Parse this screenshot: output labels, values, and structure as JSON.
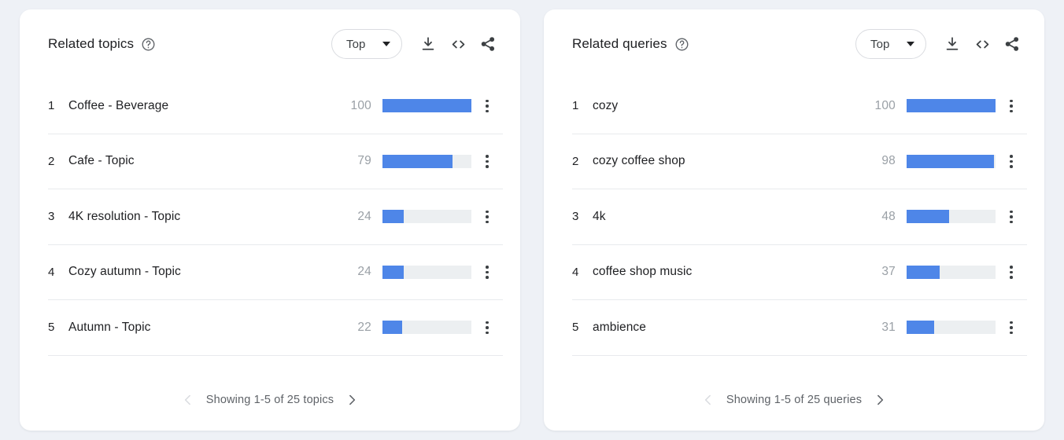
{
  "theme": {
    "page_background": "#eef1f6",
    "card_background": "#ffffff",
    "bar_fill_color": "#4e86e8",
    "bar_track_color": "#eceff1",
    "primary_text_color": "#202124",
    "muted_text_color": "#9aa0a6"
  },
  "panels": [
    {
      "title": "Related topics",
      "help_icon": "help-circle-icon",
      "sort_select": {
        "value": "Top",
        "caret_icon": "chevron-down-icon"
      },
      "actions": [
        {
          "name": "download-button",
          "icon": "download-icon"
        },
        {
          "name": "embed-button",
          "icon": "code-embed-icon"
        },
        {
          "name": "share-button",
          "icon": "share-icon"
        }
      ],
      "rows": [
        {
          "rank": "1",
          "label": "Coffee - Beverage",
          "value": "100",
          "percent": 100
        },
        {
          "rank": "2",
          "label": "Cafe - Topic",
          "value": "79",
          "percent": 79
        },
        {
          "rank": "3",
          "label": "4K resolution - Topic",
          "value": "24",
          "percent": 24
        },
        {
          "rank": "4",
          "label": "Cozy autumn - Topic",
          "value": "24",
          "percent": 24
        },
        {
          "rank": "5",
          "label": "Autumn - Topic",
          "value": "22",
          "percent": 22
        }
      ],
      "footer": {
        "prev_icon": "chevron-left-icon",
        "next_icon": "chevron-right-icon",
        "text": "Showing 1-5 of 25 topics",
        "prev_enabled": false,
        "next_enabled": true
      }
    },
    {
      "title": "Related queries",
      "help_icon": "help-circle-icon",
      "sort_select": {
        "value": "Top",
        "caret_icon": "chevron-down-icon"
      },
      "actions": [
        {
          "name": "download-button",
          "icon": "download-icon"
        },
        {
          "name": "embed-button",
          "icon": "code-embed-icon"
        },
        {
          "name": "share-button",
          "icon": "share-icon"
        }
      ],
      "rows": [
        {
          "rank": "1",
          "label": "cozy",
          "value": "100",
          "percent": 100
        },
        {
          "rank": "2",
          "label": "cozy coffee shop",
          "value": "98",
          "percent": 98
        },
        {
          "rank": "3",
          "label": "4k",
          "value": "48",
          "percent": 48
        },
        {
          "rank": "4",
          "label": "coffee shop music",
          "value": "37",
          "percent": 37
        },
        {
          "rank": "5",
          "label": "ambience",
          "value": "31",
          "percent": 31
        }
      ],
      "footer": {
        "prev_icon": "chevron-left-icon",
        "next_icon": "chevron-right-icon",
        "text": "Showing 1-5 of 25 queries",
        "prev_enabled": false,
        "next_enabled": true
      }
    }
  ],
  "chart_data": [
    {
      "type": "bar",
      "title": "Related topics",
      "categories": [
        "Coffee - Beverage",
        "Cafe - Topic",
        "4K resolution - Topic",
        "Cozy autumn - Topic",
        "Autumn - Topic"
      ],
      "values": [
        100,
        79,
        24,
        24,
        22
      ],
      "xlabel": "",
      "ylabel": "",
      "ylim": [
        0,
        100
      ],
      "grid": false,
      "legend": "none",
      "orientation": "horizontal"
    },
    {
      "type": "bar",
      "title": "Related queries",
      "categories": [
        "cozy",
        "cozy coffee shop",
        "4k",
        "coffee shop music",
        "ambience"
      ],
      "values": [
        100,
        98,
        48,
        37,
        31
      ],
      "xlabel": "",
      "ylabel": "",
      "ylim": [
        0,
        100
      ],
      "grid": false,
      "legend": "none",
      "orientation": "horizontal"
    }
  ]
}
